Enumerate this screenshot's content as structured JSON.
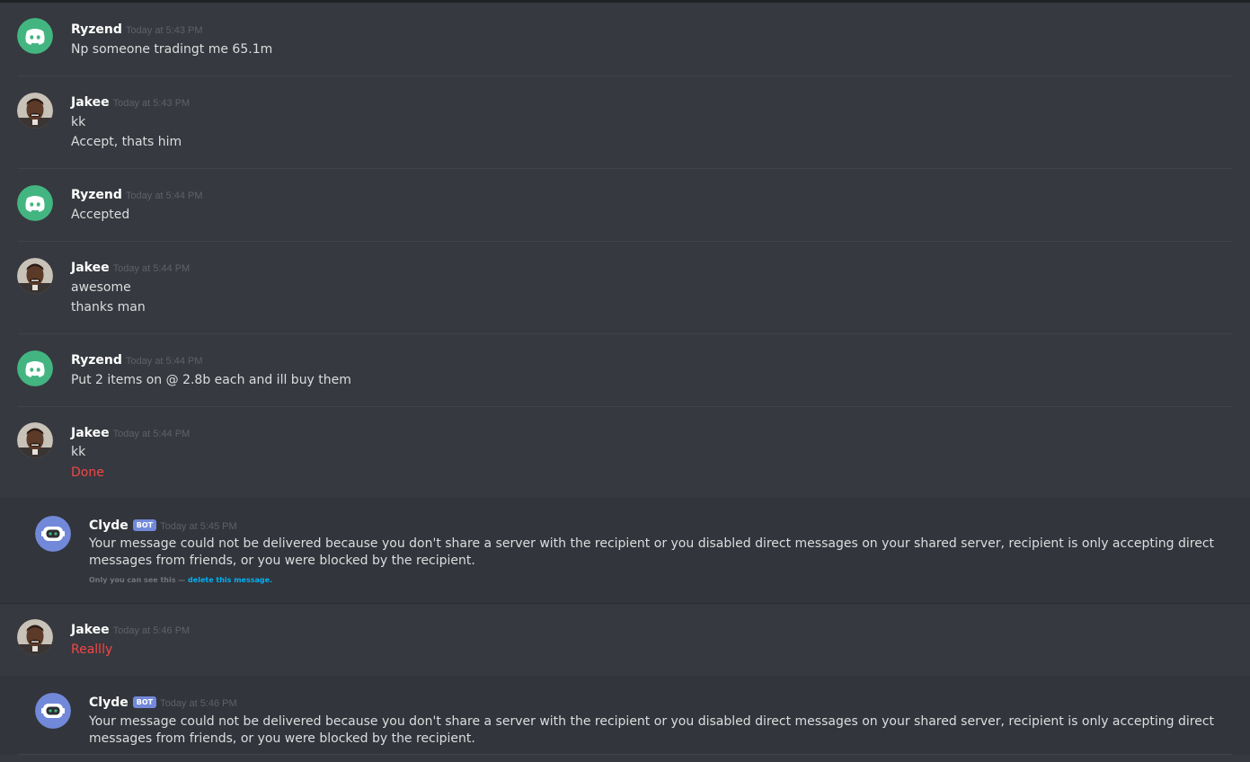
{
  "colors": {
    "background": "#36393f",
    "bot_row_background": "#32353b",
    "username": "#ffffff",
    "message_text": "#dcddde",
    "timestamp": "#5f6166",
    "emphasis_red": "#f04747",
    "bot_tag": "#7289da",
    "link": "#00b0f4",
    "discord_green": "#43b581"
  },
  "messages": [
    {
      "author": "Ryzend",
      "avatar": "discord-logo-green-icon",
      "timestamp": "Today at 5:43 PM",
      "lines": [
        "Np someone tradingt me 65.1m"
      ]
    },
    {
      "author": "Jakee",
      "avatar": "user-photo-avatar",
      "timestamp": "Today at 5:43 PM",
      "lines": [
        "kk",
        "Accept, thats him"
      ]
    },
    {
      "author": "Ryzend",
      "avatar": "discord-logo-green-icon",
      "timestamp": "Today at 5:44 PM",
      "lines": [
        "Accepted"
      ]
    },
    {
      "author": "Jakee",
      "avatar": "user-photo-avatar",
      "timestamp": "Today at 5:44 PM",
      "lines": [
        "awesome",
        "thanks man"
      ]
    },
    {
      "author": "Ryzend",
      "avatar": "discord-logo-green-icon",
      "timestamp": "Today at 5:44 PM",
      "lines": [
        "Put 2 items on @ 2.8b each and ill buy them"
      ]
    },
    {
      "author": "Jakee",
      "avatar": "user-photo-avatar",
      "timestamp": "Today at 5:44 PM",
      "lines": [
        "kk",
        "Done"
      ],
      "red_lines": [
        1
      ]
    },
    {
      "author": "Clyde",
      "bot_tag": "BOT",
      "avatar": "clyde-bot-icon",
      "timestamp": "Today at 5:45 PM",
      "text": "Your message could not be delivered because you don't share a server with the recipient or you disabled direct messages on your shared server, recipient is only accepting direct messages from friends, or you were blocked by the recipient.",
      "ephemeral_note": "Only you can see this — ",
      "ephemeral_link": "delete this message."
    },
    {
      "author": "Jakee",
      "avatar": "user-photo-avatar",
      "timestamp": "Today at 5:46 PM",
      "lines": [
        "Reallly"
      ],
      "red_lines": [
        0
      ]
    },
    {
      "author": "Clyde",
      "bot_tag": "BOT",
      "avatar": "clyde-bot-icon",
      "timestamp": "Today at 5:46 PM",
      "text": "Your message could not be delivered because you don't share a server with the recipient or you disabled direct messages on your shared server, recipient is only accepting direct messages from friends, or you were blocked by the recipient."
    }
  ]
}
